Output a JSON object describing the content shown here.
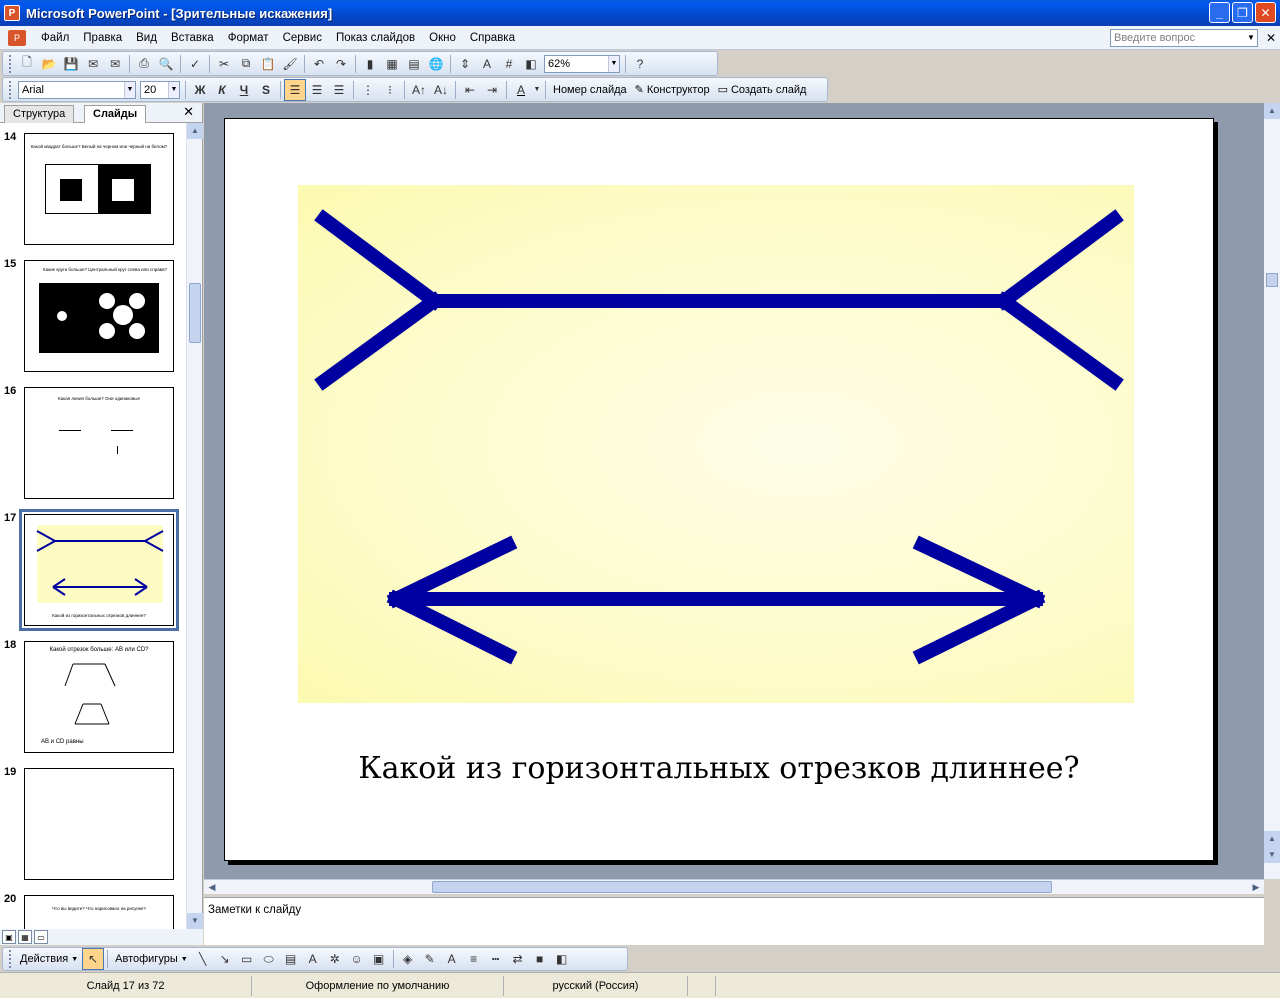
{
  "window": {
    "app_icon": "powerpoint-icon",
    "title": "Microsoft PowerPoint - [Зрительные искажения]",
    "buttons": [
      "minimize",
      "restore",
      "close"
    ]
  },
  "menu": {
    "items": [
      "Файл",
      "Правка",
      "Вид",
      "Вставка",
      "Формат",
      "Сервис",
      "Показ слайдов",
      "Окно",
      "Справка"
    ],
    "ask_placeholder": "Введите вопрос"
  },
  "toolbar_standard": {
    "zoom": "62%"
  },
  "toolbar_formatting": {
    "font": "Arial",
    "size": "20",
    "bold": "Ж",
    "italic": "К",
    "underline": "Ч",
    "shadow": "S",
    "slide_number": "Номер слайда",
    "designer": "Конструктор",
    "new_slide": "Создать слайд"
  },
  "left_panel": {
    "tab_outline": "Структура",
    "tab_slides": "Слайды",
    "thumbnails": [
      {
        "num": "14",
        "text": "Какой квадрат больше? Белый на черном или черный на белом?"
      },
      {
        "num": "15",
        "text": "Какие круги больше? Центральный круг слева или справа?"
      },
      {
        "num": "16",
        "text": "Какая линия больше? Они одинаковые"
      },
      {
        "num": "17",
        "text": "Какой из горизонтальных отрезков длиннее?"
      },
      {
        "num": "18",
        "text": "Какой отрезок больше: AB или CD?",
        "footer": "AB и CD равны"
      },
      {
        "num": "19",
        "text": ""
      },
      {
        "num": "20",
        "text": "Что вы видите? Что нарисовано на рисунке?"
      }
    ]
  },
  "slide": {
    "caption": "Какой из горизонтальных отрезков длиннее?",
    "line_color": "#0000A0",
    "background_color": "#FDFBC4"
  },
  "notes": {
    "placeholder": "Заметки к слайду"
  },
  "draw_toolbar": {
    "actions": "Действия",
    "autoshapes": "Автофигуры"
  },
  "status": {
    "slide": "Слайд 17 из 72",
    "design": "Оформление по умолчанию",
    "language": "русский (Россия)"
  }
}
